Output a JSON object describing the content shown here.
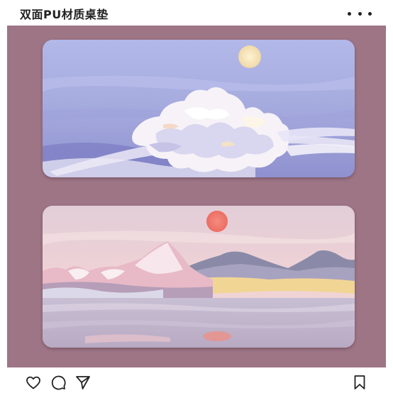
{
  "post": {
    "title": "双面PU材质桌垫"
  },
  "icons": {
    "more": "more-icon",
    "like": "heart-icon",
    "comment": "comment-icon",
    "share": "send-icon",
    "save": "bookmark-icon"
  },
  "colors": {
    "background": "#9d7585",
    "mat_top_sky": "#a9aee4",
    "mat_bottom_sky": "#e9cdd5",
    "sun_top": "#f4e0b5",
    "sun_bottom": "#f07a6e"
  }
}
